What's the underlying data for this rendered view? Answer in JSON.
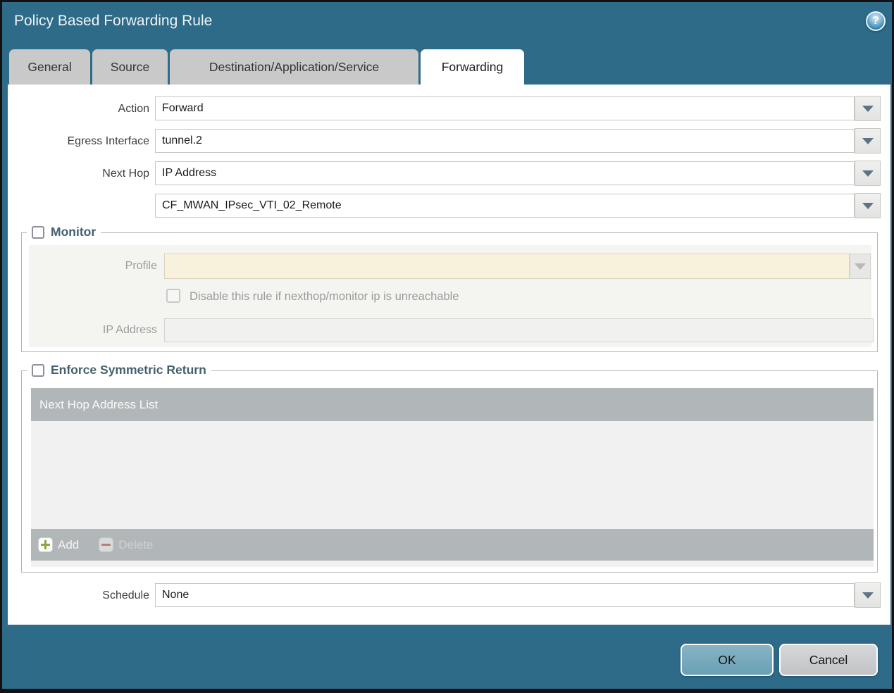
{
  "window": {
    "title": "Policy Based Forwarding Rule",
    "help_icon_glyph": "?"
  },
  "tabs": [
    {
      "label": "General",
      "active": false
    },
    {
      "label": "Source",
      "active": false
    },
    {
      "label": "Destination/Application/Service",
      "active": false
    },
    {
      "label": "Forwarding",
      "active": true
    }
  ],
  "form": {
    "action": {
      "label": "Action",
      "value": "Forward"
    },
    "egress_interface": {
      "label": "Egress Interface",
      "value": "tunnel.2"
    },
    "next_hop": {
      "label": "Next Hop",
      "value": "IP Address"
    },
    "next_hop_address": {
      "value": "CF_MWAN_IPsec_VTI_02_Remote"
    },
    "schedule": {
      "label": "Schedule",
      "value": "None"
    }
  },
  "monitor": {
    "title": "Monitor",
    "checked": false,
    "profile": {
      "label": "Profile",
      "value": ""
    },
    "disable_rule_label": "Disable this rule if nexthop/monitor ip is unreachable",
    "disable_rule_checked": false,
    "ip_address": {
      "label": "IP Address",
      "value": ""
    }
  },
  "symmetric_return": {
    "title": "Enforce Symmetric Return",
    "checked": false,
    "table": {
      "header": "Next Hop Address List",
      "rows": []
    },
    "add_label": "Add",
    "delete_label": "Delete"
  },
  "footer": {
    "ok_label": "OK",
    "cancel_label": "Cancel"
  },
  "colors": {
    "accent_teal": "#2e6b89",
    "tab_inactive": "#c9c9c9",
    "section_title": "#44606e",
    "table_header_gray": "#b1b6b9",
    "disabled_cream_field": "#f8f1dc",
    "ok_button": "#74a7bb",
    "cancel_button": "#c9cbce"
  }
}
